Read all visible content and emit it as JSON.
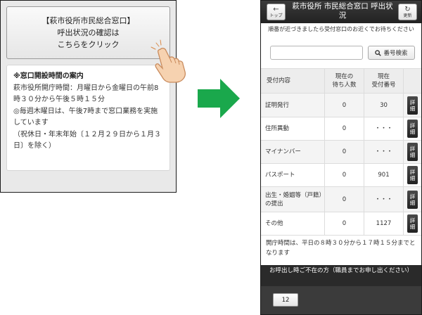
{
  "left_screen": {
    "call_button_lines": [
      "【萩市役所市民総合窓口】",
      "呼出状況の確認は",
      "こちらをクリック"
    ],
    "info": {
      "heading": "※窓口開設時間の案内",
      "line1": "萩市役所開庁時間：月曜日から金曜日の午前8時３０分から午後５時１５分",
      "line2": "◎毎週木曜日は、午後7時まで窓口業務を実施しています",
      "line3": "（祝休日・年末年始〔１２月２９日から１月３日〕を除く）"
    }
  },
  "right_screen": {
    "title": "萩市役所 市民総合窓口 呼出状況",
    "back_label": "トップ",
    "refresh_label": "更新",
    "notice": "順番が近づきましたら受付窓口のお近くでお待ちください",
    "search": {
      "value": "",
      "button_label": "番号検索"
    },
    "table": {
      "headers": [
        "受付内容",
        "現在の\n待ち人数",
        "現在\n受付番号",
        ""
      ],
      "rows": [
        {
          "name": "証明発行",
          "waiting": "0",
          "number": "30",
          "detail": "詳細"
        },
        {
          "name": "住所異動",
          "waiting": "0",
          "number": "・・・",
          "detail": "詳細"
        },
        {
          "name": "マイナンバー",
          "waiting": "0",
          "number": "・・・",
          "detail": "詳細"
        },
        {
          "name": "パスポート",
          "waiting": "0",
          "number": "901",
          "detail": "詳細"
        },
        {
          "name": "出生・婚姻等（戸籍）の提出",
          "waiting": "0",
          "number": "・・・",
          "detail": "詳細"
        },
        {
          "name": "その他",
          "waiting": "0",
          "number": "1127",
          "detail": "詳細"
        }
      ]
    },
    "hours_text": "開庁時間は、平日の８時３０分から１７時１５分までとなります",
    "absent_bar": "お呼出し時ご不在の方（職員までお申し出ください）",
    "absent_numbers": [
      "12"
    ]
  },
  "colors": {
    "arrow": "#1aa84c",
    "titlebar": "#2b2b2b",
    "skin": "#f6d2b0"
  },
  "icons": [
    "finger-pointing-hand-icon",
    "right-arrow-icon",
    "back-arrow-icon",
    "refresh-icon",
    "search-icon"
  ]
}
